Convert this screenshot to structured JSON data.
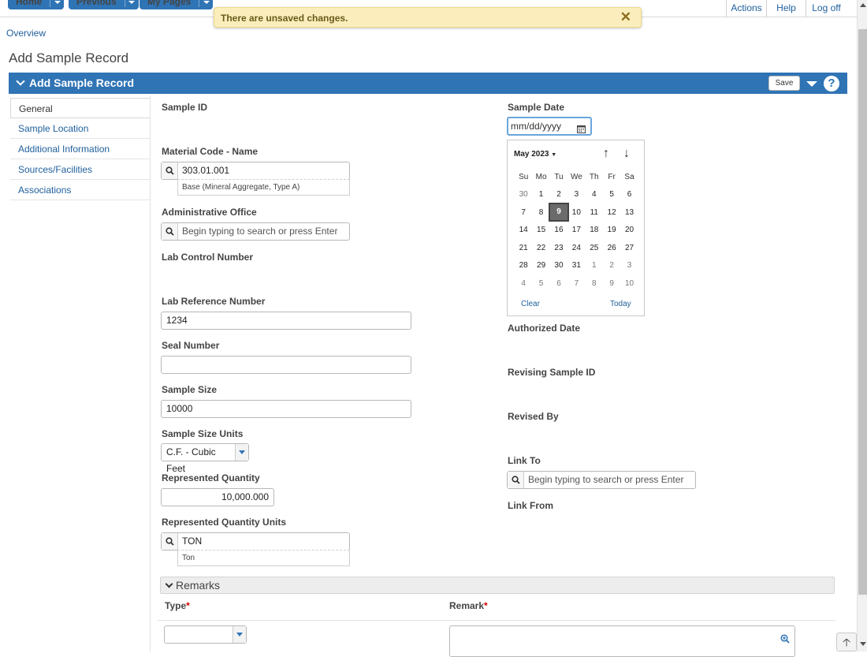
{
  "nav": {
    "home": "Home",
    "previous": "Previous",
    "mypages": "My Pages",
    "actions": "Actions",
    "help": "Help",
    "logoff": "Log off"
  },
  "toast": {
    "message": "There are unsaved changes.",
    "close": "✕"
  },
  "breadcrumb": "Overview",
  "page_title": "Add Sample Record",
  "panel": {
    "title": "Add Sample Record",
    "save_label": "Save",
    "help_glyph": "?"
  },
  "sidebar": {
    "items": [
      {
        "label": "General"
      },
      {
        "label": "Sample Location"
      },
      {
        "label": "Additional Information"
      },
      {
        "label": "Sources/Facilities"
      },
      {
        "label": "Associations"
      }
    ]
  },
  "form": {
    "sample_id_label": "Sample ID",
    "material_label": "Material Code - Name",
    "material_value": "303.01.001",
    "material_desc": "Base (Mineral Aggregate, Type A)",
    "admin_office_label": "Administrative Office",
    "admin_office_placeholder": "Begin typing to search or press Enter",
    "lab_control_label": "Lab Control Number",
    "lab_ref_label": "Lab Reference Number",
    "lab_ref_value": "1234",
    "seal_label": "Seal Number",
    "seal_value": "",
    "sample_size_label": "Sample Size",
    "sample_size_value": "10000",
    "sample_size_units_label": "Sample Size Units",
    "sample_size_units_value": "C.F. - Cubic Feet",
    "rep_qty_label": "Represented Quantity",
    "rep_qty_value": "10,000.000",
    "rep_qty_units_label": "Represented Quantity Units",
    "rep_qty_units_value": "TON",
    "rep_qty_units_desc": "Ton",
    "sample_date_label": "Sample Date",
    "sample_date_placeholder": "mm/dd/yyyy",
    "authorized_date_label": "Authorized Date",
    "revising_label": "Revising Sample ID",
    "revised_by_label": "Revised By",
    "link_to_label": "Link To",
    "link_to_placeholder": "Begin typing to search or press Enter",
    "link_from_label": "Link From"
  },
  "datepicker": {
    "month_label": "May 2023",
    "weekdays": [
      "Su",
      "Mo",
      "Tu",
      "We",
      "Th",
      "Fr",
      "Sa"
    ],
    "weeks": [
      [
        "30",
        "1",
        "2",
        "3",
        "4",
        "5",
        "6"
      ],
      [
        "7",
        "8",
        "9",
        "10",
        "11",
        "12",
        "13"
      ],
      [
        "14",
        "15",
        "16",
        "17",
        "18",
        "19",
        "20"
      ],
      [
        "21",
        "22",
        "23",
        "24",
        "25",
        "26",
        "27"
      ],
      [
        "28",
        "29",
        "30",
        "31",
        "1",
        "2",
        "3"
      ],
      [
        "4",
        "5",
        "6",
        "7",
        "8",
        "9",
        "10"
      ]
    ],
    "selected_day": "9",
    "clear": "Clear",
    "today": "Today",
    "prev_glyph": "↑",
    "next_glyph": "↓"
  },
  "remarks": {
    "title": "Remarks",
    "type_label": "Type",
    "remark_label": "Remark",
    "required_marker": "*"
  },
  "scroll_top_glyph": "🡡"
}
